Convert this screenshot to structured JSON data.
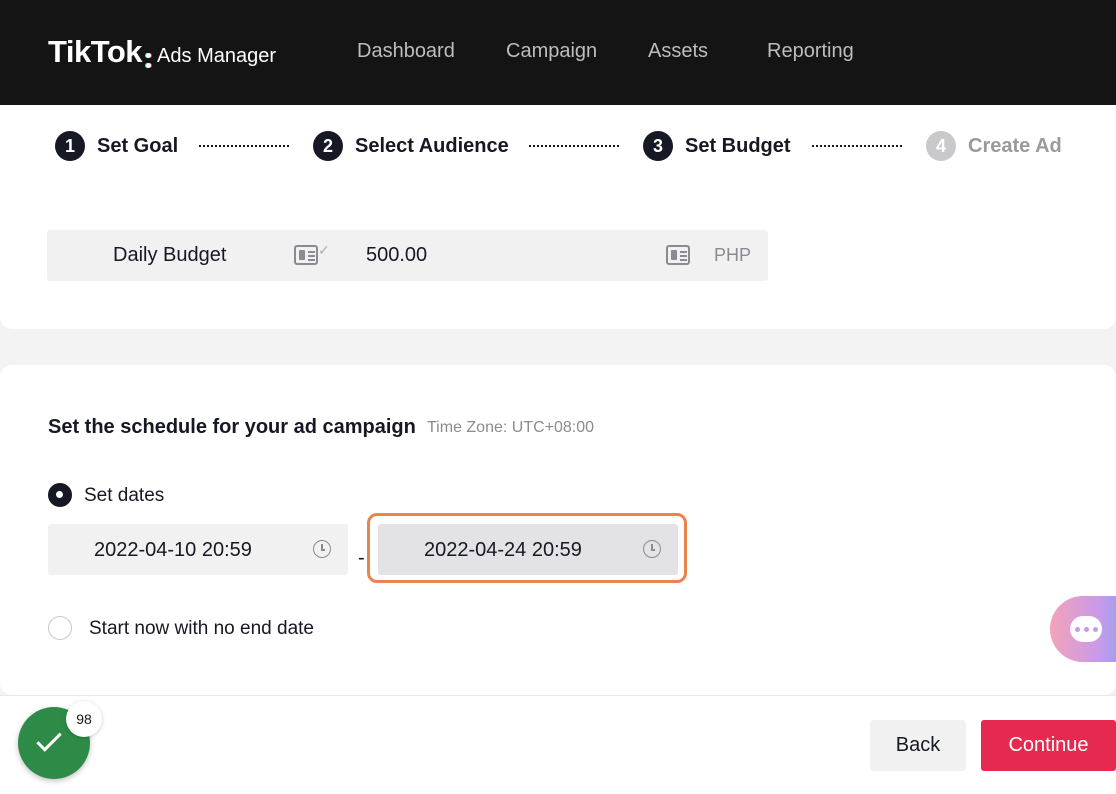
{
  "header": {
    "brand": "TikTok",
    "brand_sub": "Ads Manager",
    "nav": [
      {
        "label": "Dashboard"
      },
      {
        "label": "Campaign"
      },
      {
        "label": "Assets"
      },
      {
        "label": "Reporting"
      }
    ]
  },
  "steps": [
    {
      "num": "1",
      "label": "Set Goal",
      "active": true
    },
    {
      "num": "2",
      "label": "Select Audience",
      "active": true
    },
    {
      "num": "3",
      "label": "Set Budget",
      "active": true
    },
    {
      "num": "4",
      "label": "Create Ad",
      "active": false
    }
  ],
  "budget": {
    "label": "Daily Budget",
    "value": "500.00",
    "currency": "PHP"
  },
  "schedule": {
    "title": "Set the schedule for your ad campaign",
    "timezone": "Time Zone: UTC+08:00",
    "option_set_dates": "Set dates",
    "start_date": "2022-04-10 20:59",
    "separator": "-",
    "end_date": "2022-04-24 20:59",
    "option_no_end": "Start now with no end date",
    "selected_option": "Set dates"
  },
  "footer": {
    "back_label": "Back",
    "continue_label": "Continue"
  },
  "badge": {
    "count": "98"
  },
  "colors": {
    "header_bg": "#141414",
    "primary": "#e5294f",
    "highlight_border": "#e8854f",
    "badge_green": "#2e8b47"
  }
}
